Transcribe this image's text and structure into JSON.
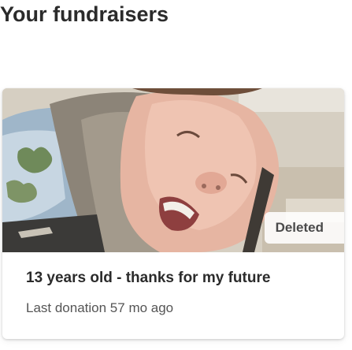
{
  "page": {
    "title": "Your fundraisers"
  },
  "fundraisers": [
    {
      "title": "13 years old - thanks for my future",
      "status": "Deleted",
      "last_donation": "Last donation 57 mo ago",
      "image_description_icon": "fundraiser-photo"
    }
  ],
  "colors": {
    "title_text": "#2b2b2b",
    "meta_text": "#555555",
    "badge_bg": "#ffffff",
    "card_bg": "#ffffff"
  }
}
